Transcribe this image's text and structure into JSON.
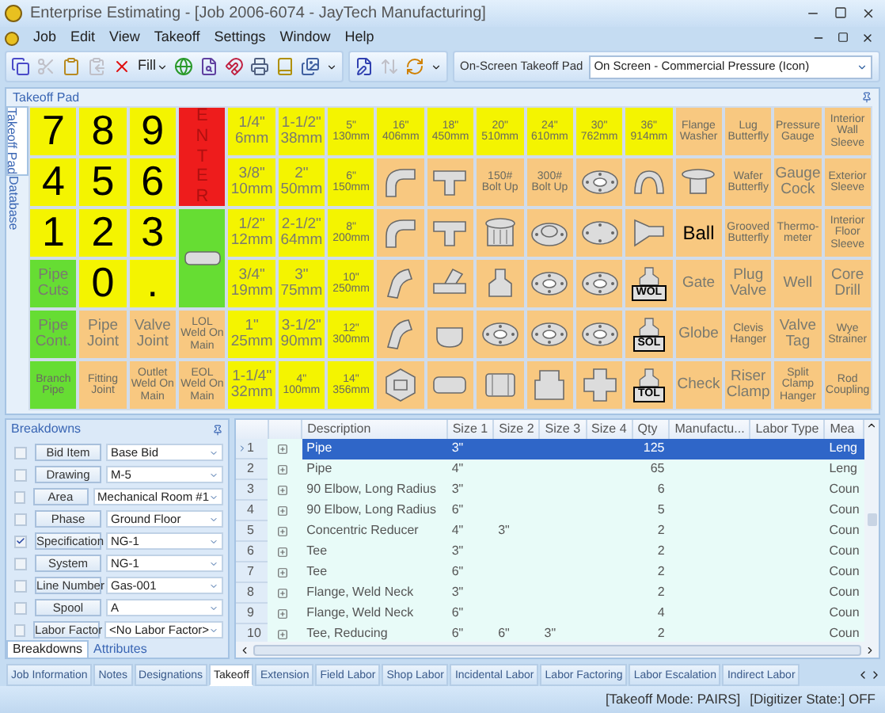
{
  "window": {
    "title": "Enterprise Estimating - [Job 2006-6074 - JayTech Manufacturing]"
  },
  "menu": [
    "Job",
    "Edit",
    "View",
    "Takeoff",
    "Settings",
    "Window",
    "Help"
  ],
  "toolbar": {
    "groups": [
      [
        {
          "kind": "copy",
          "disabled": false
        },
        {
          "kind": "cut",
          "disabled": true
        },
        {
          "kind": "paste",
          "disabled": false
        },
        {
          "kind": "paste-special",
          "disabled": true
        },
        {
          "kind": "delete",
          "disabled": false
        },
        {
          "kind": "fill",
          "text": "Fill",
          "disabled": false
        },
        {
          "kind": "web",
          "disabled": false
        },
        {
          "kind": "zoom",
          "disabled": false
        },
        {
          "kind": "magnet",
          "disabled": false
        },
        {
          "kind": "print",
          "disabled": false
        },
        {
          "kind": "book",
          "disabled": false
        },
        {
          "kind": "images",
          "disabled": false
        }
      ],
      [
        {
          "kind": "edit",
          "disabled": false
        },
        {
          "kind": "move",
          "disabled": true
        },
        {
          "kind": "refresh",
          "disabled": false
        }
      ]
    ],
    "pad_label": "On-Screen Takeoff Pad",
    "pad_value": "On Screen - Commercial Pressure (Icon)"
  },
  "takeoff_pad": {
    "title": "Takeoff Pad",
    "side_tabs": [
      {
        "label": "Takeoff Pad",
        "selected": true
      },
      {
        "label": "Database",
        "selected": false
      }
    ],
    "cells": [
      {
        "kind": "digit",
        "text": "7",
        "color": "#f4f400"
      },
      {
        "kind": "digit",
        "text": "8",
        "color": "#f4f400"
      },
      {
        "kind": "digit",
        "text": "9",
        "color": "#f4f400"
      },
      {
        "kind": "enter",
        "text": "ENTER",
        "color": "#ee1c1c",
        "tall": true
      },
      {
        "kind": "label",
        "text": "1/4\" 6mm",
        "color": "#f4f400"
      },
      {
        "kind": "label",
        "text": "1-1/2\" 38mm",
        "color": "#f4f400"
      },
      {
        "kind": "small",
        "text": "5\" 130mm",
        "color": "#f4f400"
      },
      {
        "kind": "small",
        "text": "16\" 406mm",
        "color": "#f4f400"
      },
      {
        "kind": "small",
        "text": "18\" 450mm",
        "color": "#f4f400"
      },
      {
        "kind": "small",
        "text": "20\" 510mm",
        "color": "#f4f400"
      },
      {
        "kind": "small",
        "text": "24\" 610mm",
        "color": "#f4f400"
      },
      {
        "kind": "small",
        "text": "30\" 762mm",
        "color": "#f4f400"
      },
      {
        "kind": "small",
        "text": "36\" 914mm",
        "color": "#f4f400"
      },
      {
        "kind": "small",
        "text": "Flange Washer",
        "color": "#f8c880"
      },
      {
        "kind": "small",
        "text": "Lug Butterfly",
        "color": "#f8c880"
      },
      {
        "kind": "small",
        "text": "Pressure Gauge",
        "color": "#f8c880"
      },
      {
        "kind": "small",
        "text": "Interior Wall Sleeve",
        "color": "#f8c880"
      },
      {
        "kind": "digit",
        "text": "4",
        "color": "#f4f400"
      },
      {
        "kind": "digit",
        "text": "5",
        "color": "#f4f400"
      },
      {
        "kind": "digit",
        "text": "6",
        "color": "#f4f400"
      },
      {
        "kind": "label",
        "text": "3/8\" 10mm",
        "color": "#f4f400"
      },
      {
        "kind": "label",
        "text": "2\" 50mm",
        "color": "#f4f400"
      },
      {
        "kind": "small",
        "text": "6\" 150mm",
        "color": "#f4f400"
      },
      {
        "kind": "elbow",
        "color": "#f8c880"
      },
      {
        "kind": "tee",
        "color": "#f8c880"
      },
      {
        "kind": "small",
        "text": "150# Bolt Up",
        "color": "#f8c880"
      },
      {
        "kind": "small",
        "text": "300# Bolt Up",
        "color": "#f8c880"
      },
      {
        "kind": "flange",
        "color": "#f8c880"
      },
      {
        "kind": "return",
        "color": "#f8c880"
      },
      {
        "kind": "washer",
        "color": "#f8c880"
      },
      {
        "kind": "small",
        "text": "Wafer Butterfly",
        "color": "#f8c880"
      },
      {
        "kind": "label",
        "text": "Gauge Cock",
        "color": "#f8c880"
      },
      {
        "kind": "small",
        "text": "Exterior Sleeve",
        "color": "#f8c880"
      },
      {
        "kind": "digit",
        "text": "1",
        "color": "#f4f400"
      },
      {
        "kind": "digit",
        "text": "2",
        "color": "#f4f400"
      },
      {
        "kind": "digit",
        "text": "3",
        "color": "#f4f400"
      },
      {
        "kind": "pipe",
        "color": "#66dd33",
        "tall": true
      },
      {
        "kind": "label",
        "text": "1/2\" 12mm",
        "color": "#f4f400"
      },
      {
        "kind": "label",
        "text": "2-1/2\" 64mm",
        "color": "#f4f400"
      },
      {
        "kind": "small",
        "text": "8\" 200mm",
        "color": "#f4f400"
      },
      {
        "kind": "elbow",
        "color": "#f8c880"
      },
      {
        "kind": "tee",
        "color": "#f8c880"
      },
      {
        "kind": "plug",
        "color": "#f8c880"
      },
      {
        "kind": "weld-neck",
        "color": "#f8c880"
      },
      {
        "kind": "blind-flange",
        "color": "#f8c880"
      },
      {
        "kind": "reducer",
        "color": "#f8c880"
      },
      {
        "kind": "dark",
        "text": "Ball",
        "color": "#f8c880"
      },
      {
        "kind": "small",
        "text": "Grooved Butterfly",
        "color": "#f8c880"
      },
      {
        "kind": "small",
        "text": "Thermo-meter",
        "color": "#f8c880"
      },
      {
        "kind": "small",
        "text": "Interior Floor Sleeve",
        "color": "#f8c880"
      },
      {
        "kind": "label",
        "text": "Pipe Cuts",
        "color": "#66dd33"
      },
      {
        "kind": "digit",
        "text": "0",
        "color": "#f4f400"
      },
      {
        "kind": "digit",
        "text": ".",
        "color": "#f4f400"
      },
      {
        "kind": "label",
        "text": "3/4\" 19mm",
        "color": "#f4f400"
      },
      {
        "kind": "label",
        "text": "3\" 75mm",
        "color": "#f4f400"
      },
      {
        "kind": "small",
        "text": "10\" 250mm",
        "color": "#f4f400"
      },
      {
        "kind": "elbow-45",
        "color": "#f8c880"
      },
      {
        "kind": "lateral",
        "color": "#f8c880"
      },
      {
        "kind": "swage",
        "color": "#f8c880"
      },
      {
        "kind": "flange",
        "color": "#f8c880"
      },
      {
        "kind": "flange",
        "color": "#f8c880"
      },
      {
        "kind": "outlet",
        "text": "WOL",
        "color": "#f8c880"
      },
      {
        "kind": "label",
        "text": "Gate",
        "color": "#f8c880"
      },
      {
        "kind": "label",
        "text": "Plug Valve",
        "color": "#f8c880"
      },
      {
        "kind": "label",
        "text": "Well",
        "color": "#f8c880"
      },
      {
        "kind": "label",
        "text": "Core Drill",
        "color": "#f8c880"
      },
      {
        "kind": "label",
        "text": "Pipe Cont.",
        "color": "#66dd33"
      },
      {
        "kind": "label",
        "text": "Pipe Joint",
        "color": "#f8c880"
      },
      {
        "kind": "label",
        "text": "Valve Joint",
        "color": "#f8c880"
      },
      {
        "kind": "small",
        "text": "LOL Weld On Main",
        "color": "#f8c880"
      },
      {
        "kind": "label",
        "text": "1\" 25mm",
        "color": "#f4f400"
      },
      {
        "kind": "label",
        "text": "3-1/2\" 90mm",
        "color": "#f4f400"
      },
      {
        "kind": "small",
        "text": "12\" 300mm",
        "color": "#f4f400"
      },
      {
        "kind": "elbow-45",
        "color": "#f8c880"
      },
      {
        "kind": "cap",
        "color": "#f8c880"
      },
      {
        "kind": "flange",
        "color": "#f8c880"
      },
      {
        "kind": "flange",
        "color": "#f8c880"
      },
      {
        "kind": "flange",
        "color": "#f8c880"
      },
      {
        "kind": "outlet",
        "text": "SOL",
        "color": "#f8c880"
      },
      {
        "kind": "label",
        "text": "Globe",
        "color": "#f8c880"
      },
      {
        "kind": "small",
        "text": "Clevis Hanger",
        "color": "#f8c880"
      },
      {
        "kind": "label",
        "text": "Valve Tag",
        "color": "#f8c880"
      },
      {
        "kind": "small",
        "text": "Wye Strainer",
        "color": "#f8c880"
      },
      {
        "kind": "small",
        "text": "Branch Pipe",
        "color": "#66dd33"
      },
      {
        "kind": "small",
        "text": "Fitting Joint",
        "color": "#f8c880"
      },
      {
        "kind": "small",
        "text": "Outlet Weld On Main",
        "color": "#f8c880"
      },
      {
        "kind": "small",
        "text": "EOL Weld On Main",
        "color": "#f8c880"
      },
      {
        "kind": "label",
        "text": "1-1/4\" 32mm",
        "color": "#f4f400"
      },
      {
        "kind": "small",
        "text": "4\" 100mm",
        "color": "#f4f400"
      },
      {
        "kind": "small",
        "text": "14\" 356mm",
        "color": "#f4f400"
      },
      {
        "kind": "union",
        "color": "#f8c880"
      },
      {
        "kind": "nipple",
        "color": "#f8c880"
      },
      {
        "kind": "coupling",
        "color": "#f8c880"
      },
      {
        "kind": "bushing",
        "color": "#f8c880"
      },
      {
        "kind": "cross",
        "color": "#f8c880"
      },
      {
        "kind": "outlet",
        "text": "TOL",
        "color": "#f8c880"
      },
      {
        "kind": "label",
        "text": "Check",
        "color": "#f8c880"
      },
      {
        "kind": "label",
        "text": "Riser Clamp",
        "color": "#f8c880"
      },
      {
        "kind": "small",
        "text": "Split Clamp Hanger",
        "color": "#f8c880"
      },
      {
        "kind": "small",
        "text": "Rod Coupling",
        "color": "#f8c880"
      }
    ]
  },
  "breakdowns": {
    "title": "Breakdowns",
    "items": [
      {
        "label": "Bid Item",
        "value": "Base Bid",
        "checked": false
      },
      {
        "label": "Drawing",
        "value": "M-5",
        "checked": false
      },
      {
        "label": "Area",
        "value": "Mechanical Room #1",
        "checked": false
      },
      {
        "label": "Phase",
        "value": "Ground Floor",
        "checked": false
      },
      {
        "label": "Specification",
        "value": "NG-1",
        "checked": true
      },
      {
        "label": "System",
        "value": "NG-1",
        "checked": false
      },
      {
        "label": "Line Number",
        "value": "Gas-001",
        "checked": false
      },
      {
        "label": "Spool",
        "value": "A",
        "checked": false
      },
      {
        "label": "Labor Factor",
        "value": "<No Labor Factor>",
        "checked": false
      }
    ],
    "tabs": [
      {
        "label": "Breakdowns",
        "selected": true
      },
      {
        "label": "Attributes",
        "selected": false
      }
    ]
  },
  "table": {
    "columns": [
      "Description",
      "Size 1",
      "Size 2",
      "Size 3",
      "Size 4",
      "Qty",
      "Manufactu...",
      "Labor Type",
      "Mea"
    ],
    "rows": [
      {
        "number": "1",
        "selected": true,
        "cells": [
          "Pipe",
          "3\"",
          "",
          "",
          "",
          "125",
          "",
          "",
          "Leng"
        ]
      },
      {
        "number": "2",
        "selected": false,
        "cells": [
          "Pipe",
          "4\"",
          "",
          "",
          "",
          "65",
          "",
          "",
          "Leng"
        ]
      },
      {
        "number": "3",
        "selected": false,
        "cells": [
          "90 Elbow, Long Radius",
          "3\"",
          "",
          "",
          "",
          "6",
          "",
          "",
          "Coun"
        ]
      },
      {
        "number": "4",
        "selected": false,
        "cells": [
          "90 Elbow, Long Radius",
          "6\"",
          "",
          "",
          "",
          "5",
          "",
          "",
          "Coun"
        ]
      },
      {
        "number": "5",
        "selected": false,
        "cells": [
          "Concentric Reducer",
          "4\"",
          "3\"",
          "",
          "",
          "2",
          "",
          "",
          "Coun"
        ]
      },
      {
        "number": "6",
        "selected": false,
        "cells": [
          "Tee",
          "3\"",
          "",
          "",
          "",
          "2",
          "",
          "",
          "Coun"
        ]
      },
      {
        "number": "7",
        "selected": false,
        "cells": [
          "Tee",
          "6\"",
          "",
          "",
          "",
          "2",
          "",
          "",
          "Coun"
        ]
      },
      {
        "number": "8",
        "selected": false,
        "cells": [
          "Flange, Weld Neck",
          "3\"",
          "",
          "",
          "",
          "2",
          "",
          "",
          "Coun"
        ]
      },
      {
        "number": "9",
        "selected": false,
        "cells": [
          "Flange, Weld Neck",
          "6\"",
          "",
          "",
          "",
          "4",
          "",
          "",
          "Coun"
        ]
      },
      {
        "number": "10",
        "selected": false,
        "cells": [
          "Tee, Reducing",
          "6\"",
          "6\"",
          "3\"",
          "",
          "2",
          "",
          "",
          "Coun"
        ]
      }
    ]
  },
  "bottom_tabs": [
    {
      "label": "Job Information",
      "selected": false
    },
    {
      "label": "Notes",
      "selected": false
    },
    {
      "label": "Designations",
      "selected": false
    },
    {
      "label": "Takeoff",
      "selected": true
    },
    {
      "label": "Extension",
      "selected": false
    },
    {
      "label": "Field Labor",
      "selected": false
    },
    {
      "label": "Shop Labor",
      "selected": false
    },
    {
      "label": "Incidental Labor",
      "selected": false
    },
    {
      "label": "Labor Factoring",
      "selected": false
    },
    {
      "label": "Labor Escalation",
      "selected": false
    },
    {
      "label": "Indirect Labor",
      "selected": false
    }
  ],
  "status_bar": [
    "[Takeoff Mode: PAIRS]",
    "[Digitizer State:] OFF"
  ]
}
